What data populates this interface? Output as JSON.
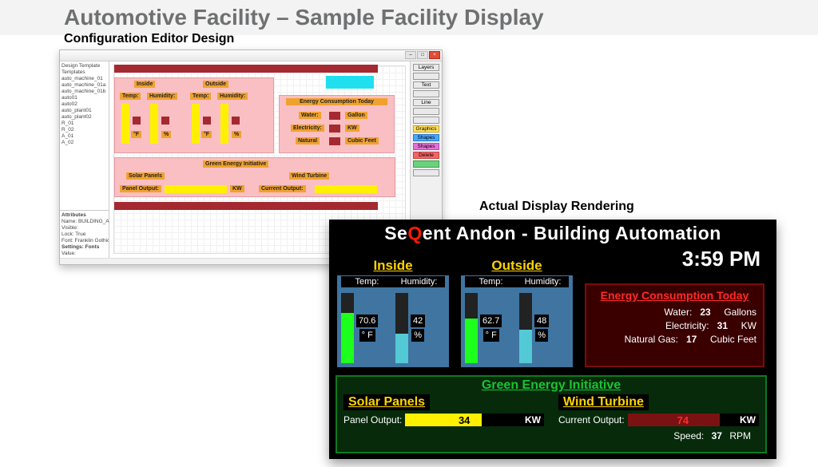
{
  "page_title": "Automotive Facility – Sample Facility Display",
  "labels": {
    "config": "Configuration Editor Design",
    "actual": "Actual Display Rendering"
  },
  "config_editor": {
    "side_buttons": [
      "Layers",
      "",
      "Text",
      "",
      "Line",
      "",
      "",
      "Graphics",
      "Shapes",
      "Shapes",
      "Delete",
      "",
      ""
    ],
    "tree": [
      "Design Template",
      "  Templates",
      "    auto_machine_01",
      "    auto_machine_01a",
      "    auto_machine_01b",
      "    auto01",
      "    auto02",
      "    auto_plant01",
      "    auto_plant02",
      "    R_01",
      "    R_02",
      "  A_01",
      "  A_02"
    ],
    "attributes": [
      "Attributes",
      "Name: BUILDING_AUTO",
      "Visible:",
      "Lock: True",
      "Font: Franklin Gothic Medium",
      "",
      "Settings: Fonts",
      "Value:"
    ],
    "canvas": {
      "inside_title": "Inside",
      "outside_title": "Outside",
      "col_labels": {
        "temp": "Temp:",
        "humidity": "Humidity:"
      },
      "units": {
        "tempF": "°F",
        "pct": "%"
      },
      "energy": {
        "title": "Energy Consumption Today",
        "rows": [
          {
            "name": "Water:",
            "unit": "Gallon"
          },
          {
            "name": "Electricity:",
            "unit": "KW"
          },
          {
            "name": "Natural",
            "unit": "Cubic Feet"
          }
        ]
      },
      "green": {
        "title": "Green Energy Initiative",
        "solar": {
          "title": "Solar Panels",
          "row": "Panel Output:",
          "unit": "KW"
        },
        "wind": {
          "title": "Wind Turbine",
          "row": "Current Output:"
        }
      }
    }
  },
  "actual": {
    "header_pre": "Se",
    "header_q": "Q",
    "header_post": "ent Andon - Building Automation",
    "clock": "3:59 PM",
    "climate": {
      "inside": {
        "title": "Inside",
        "temp": "70.6",
        "temp_unit": "° F",
        "hum": "42",
        "hum_unit": "%"
      },
      "outside": {
        "title": "Outside",
        "temp": "62.7",
        "temp_unit": "° F",
        "hum": "48",
        "hum_unit": "%"
      },
      "labels": {
        "temp": "Temp:",
        "humidity": "Humidity:"
      }
    },
    "energy": {
      "title": "Energy Consumption Today",
      "rows": [
        {
          "name": "Water:",
          "val": "23",
          "unit": "Gallons"
        },
        {
          "name": "Electricity:",
          "val": "31",
          "unit": "KW"
        },
        {
          "name": "Natural Gas:",
          "val": "17",
          "unit": "Cubic Feet"
        }
      ]
    },
    "green": {
      "title": "Green Energy Initiative",
      "solar": {
        "title": "Solar Panels",
        "label": "Panel Output:",
        "val": "34",
        "unit": "KW",
        "pct": 55
      },
      "wind": {
        "title": "Wind Turbine",
        "label": "Current Output:",
        "val": "74",
        "unit": "KW",
        "pct": 70,
        "speed_label": "Speed:",
        "speed_val": "37",
        "speed_unit": "RPM"
      }
    }
  }
}
